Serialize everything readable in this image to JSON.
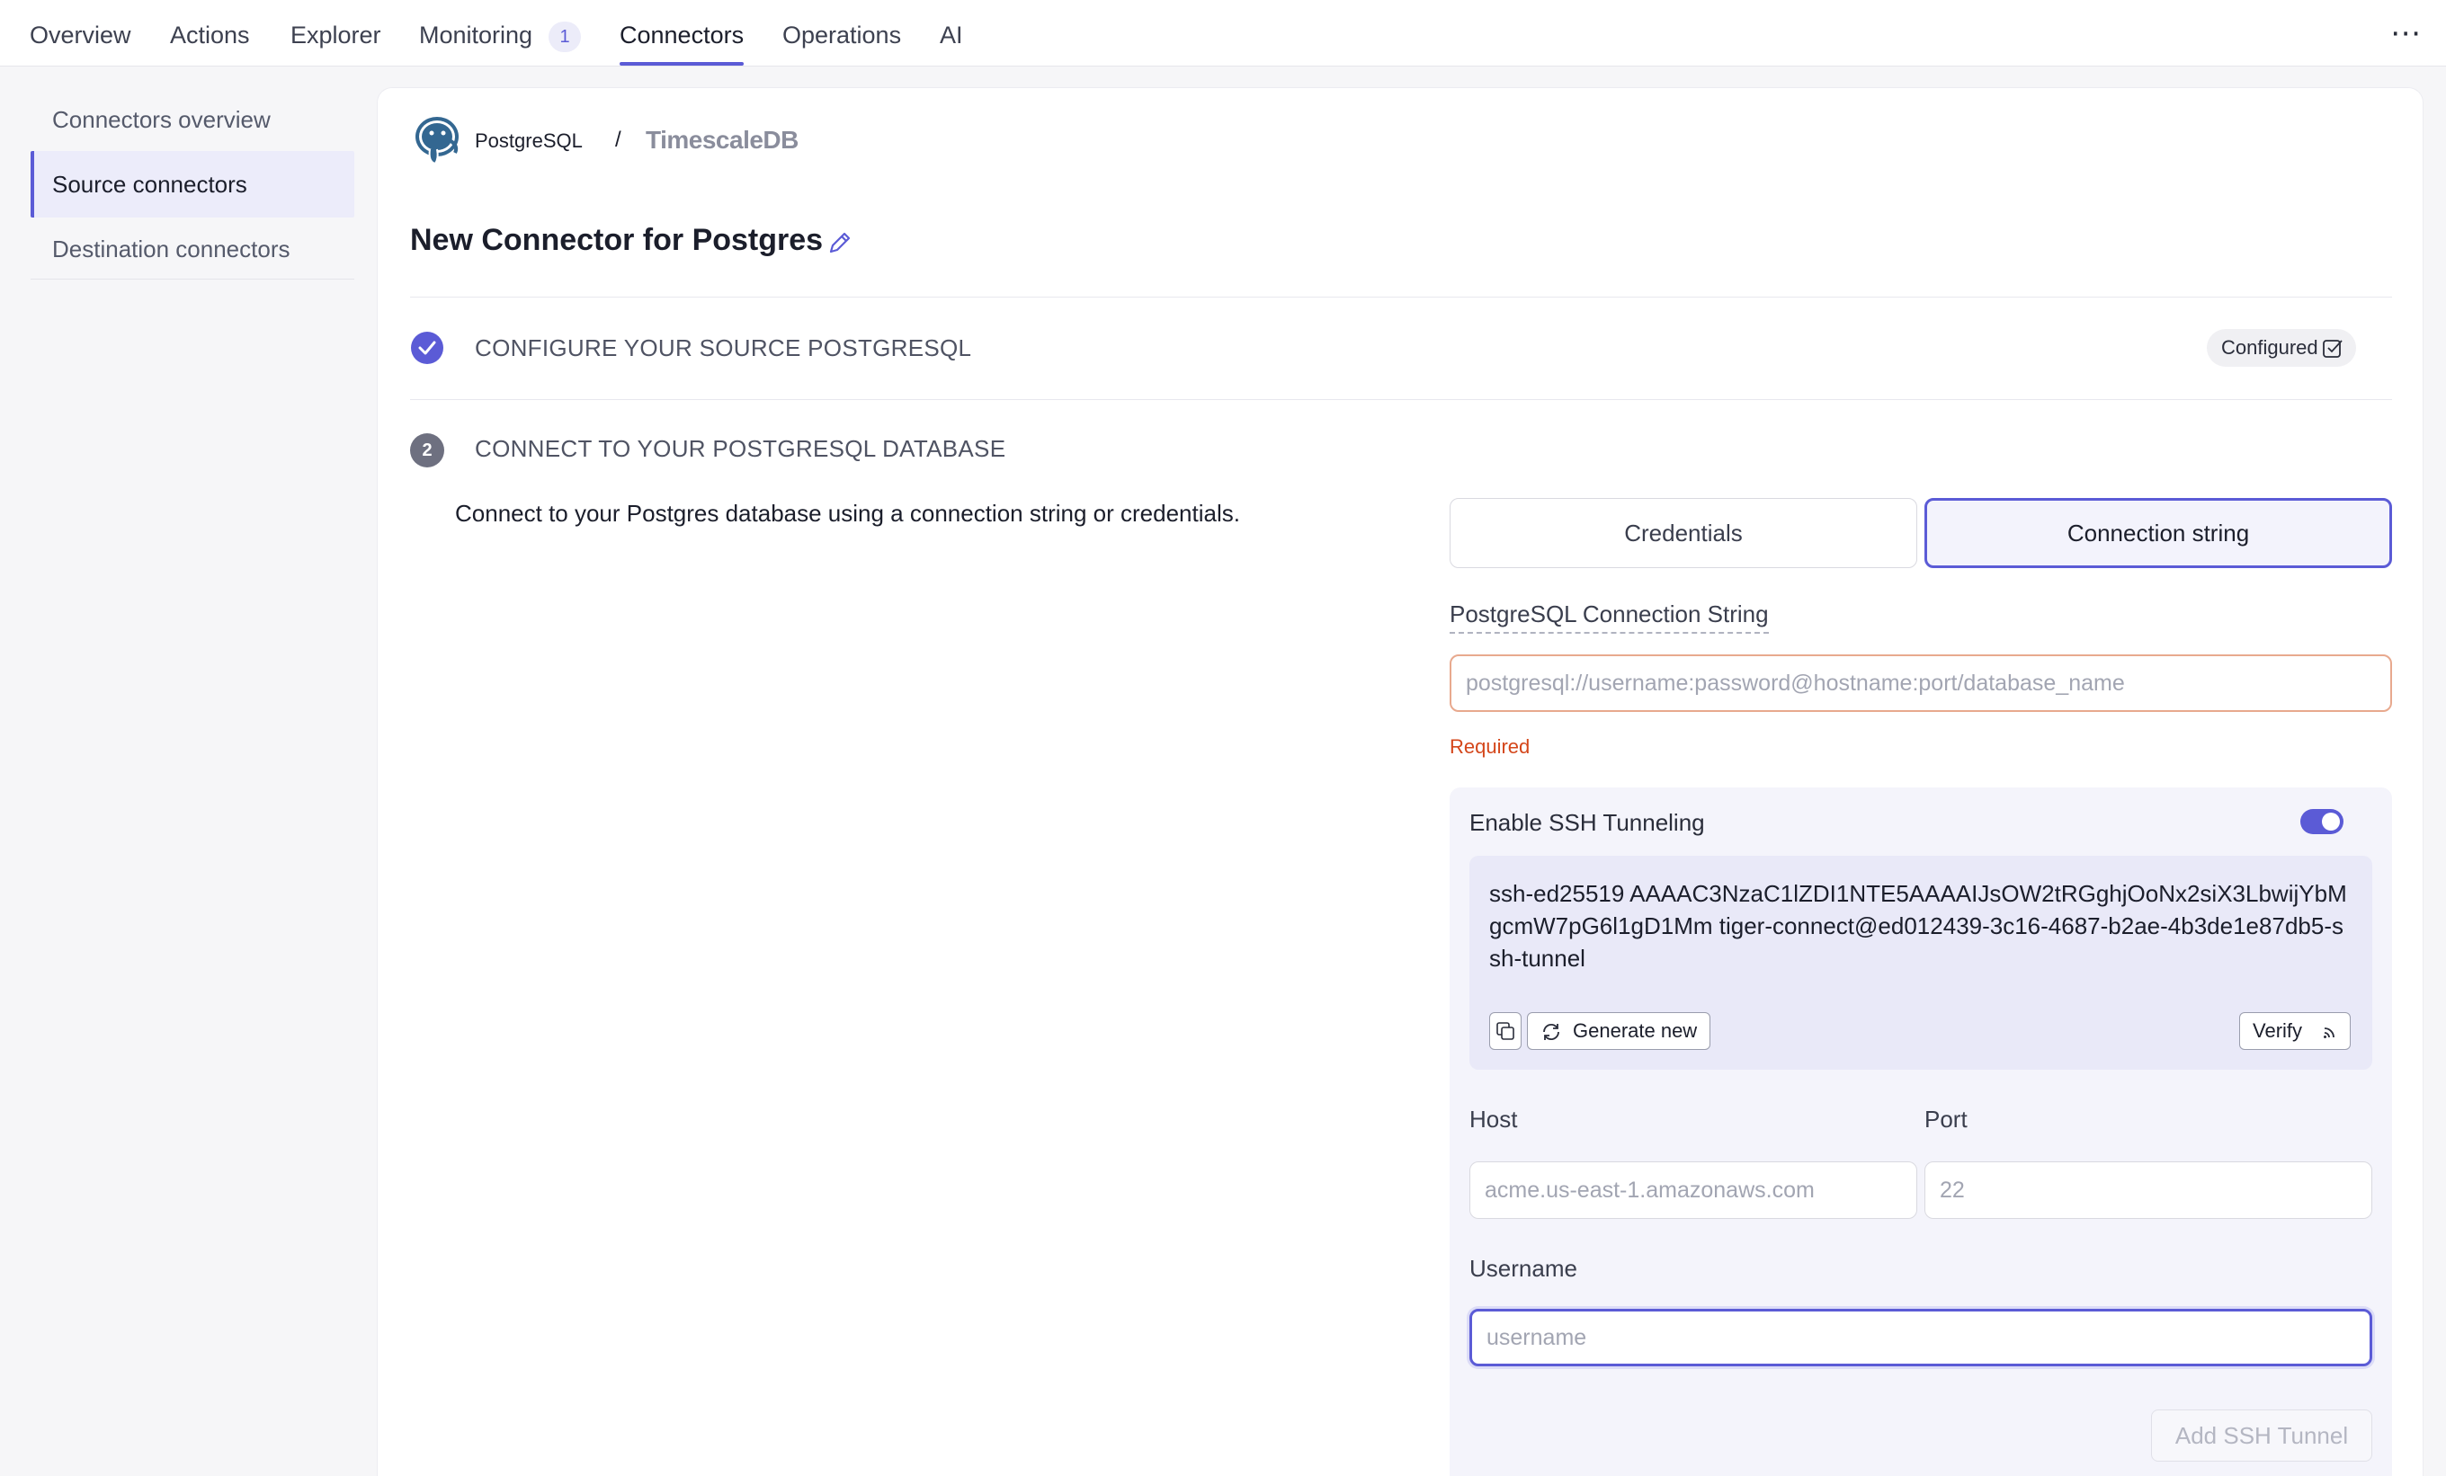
{
  "nav": {
    "tabs": [
      {
        "label": "Overview"
      },
      {
        "label": "Actions"
      },
      {
        "label": "Explorer"
      },
      {
        "label": "Monitoring",
        "badge": "1"
      },
      {
        "label": "Connectors",
        "active": true
      },
      {
        "label": "Operations"
      },
      {
        "label": "AI"
      }
    ],
    "more_icon": "more-horizontal-icon"
  },
  "sidebar": {
    "items": [
      {
        "label": "Connectors overview"
      },
      {
        "label": "Source connectors",
        "active": true
      },
      {
        "label": "Destination connectors"
      }
    ]
  },
  "breadcrumb": {
    "postgres": "PostgreSQL",
    "separator": "/",
    "timescale": "TimescaleDB"
  },
  "page": {
    "title": "New Connector for Postgres"
  },
  "steps": [
    {
      "number": "1",
      "title": "CONFIGURE YOUR SOURCE POSTGRESQL",
      "status": "Configured",
      "done": true
    },
    {
      "number": "2",
      "title": "CONNECT TO YOUR POSTGRESQL DATABASE",
      "done": false
    }
  ],
  "connect": {
    "description": "Connect to your Postgres database using a connection string or credentials.",
    "modes": [
      "Credentials",
      "Connection string"
    ],
    "active_mode": "Connection string",
    "conn_label": "PostgreSQL Connection String",
    "conn_placeholder": "postgresql://username:password@hostname:port/database_name",
    "conn_value": "",
    "error": "Required"
  },
  "ssh": {
    "title": "Enable SSH Tunneling",
    "enabled": true,
    "public_key": "ssh-ed25519 AAAAC3NzaC1lZDI1NTE5AAAAIJsOW2tRGghjOoNx2siX3LbwijYbMgcmW7pG6l1gD1Mm tiger-connect@ed012439-3c16-4687-b2ae-4b3de1e87db5-ssh-tunnel",
    "generate_label": "Generate new",
    "verify_label": "Verify",
    "host_label": "Host",
    "host_placeholder": "acme.us-east-1.amazonaws.com",
    "port_label": "Port",
    "port_placeholder": "22",
    "username_label": "Username",
    "username_placeholder": "username",
    "add_label": "Add SSH Tunnel"
  },
  "colors": {
    "accent": "#5b5bd6",
    "error": "#d4461a",
    "postgres_blue": "#336791"
  }
}
